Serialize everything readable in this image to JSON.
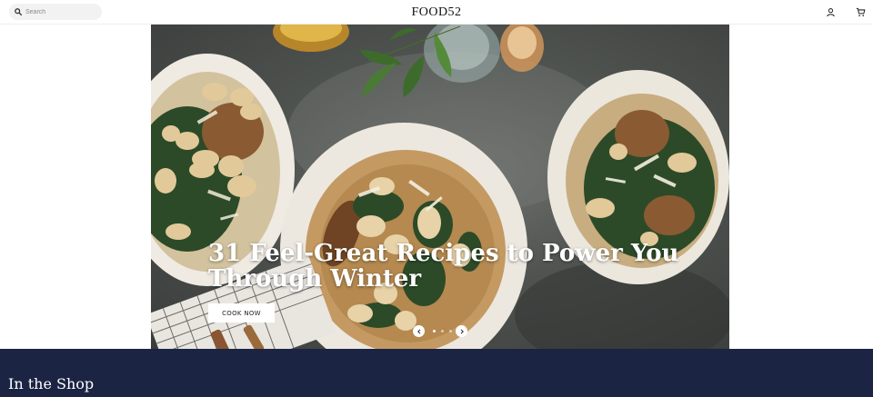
{
  "header": {
    "search_placeholder": "Search",
    "logo": "FOOD52",
    "icons": [
      "search-icon",
      "account-icon",
      "cart-icon"
    ]
  },
  "hero": {
    "headline": "31 Feel-Great Recipes to Power You Through Winter",
    "cta_label": "COOK NOW",
    "slide_count": 3,
    "active_slide": 1,
    "icons": [
      "chevron-left-icon",
      "chevron-right-icon"
    ]
  },
  "shop": {
    "heading": "In the Shop",
    "background": "#1c2444"
  }
}
